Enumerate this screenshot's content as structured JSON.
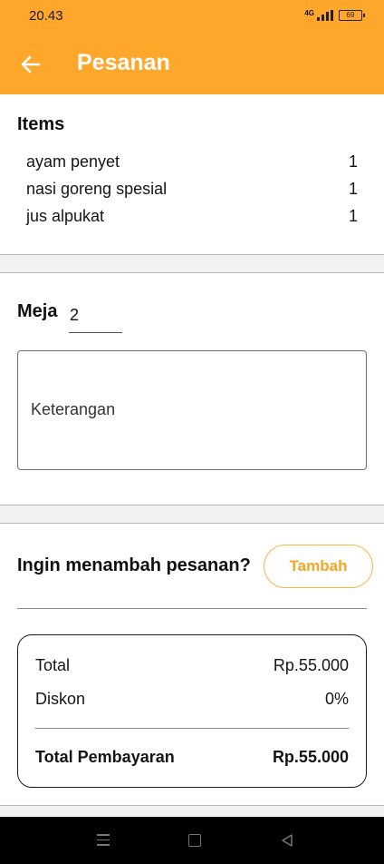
{
  "status_bar": {
    "time": "20.43",
    "network": "4G",
    "battery": "69"
  },
  "app_bar": {
    "title": "Pesanan",
    "back_icon": "arrow-left-icon"
  },
  "items": {
    "title": "Items",
    "list": [
      {
        "name": "ayam penyet",
        "qty": "1"
      },
      {
        "name": "nasi goreng spesial",
        "qty": "1"
      },
      {
        "name": "jus alpukat",
        "qty": "1"
      }
    ]
  },
  "meja": {
    "label": "Meja",
    "value": "2"
  },
  "keterangan": {
    "placeholder": "Keterangan"
  },
  "tambah": {
    "question": "Ingin menambah pesanan?",
    "button_label": "Tambah"
  },
  "summary": {
    "total_label": "Total",
    "total_value": "Rp.55.000",
    "diskon_label": "Diskon",
    "diskon_value": "0%",
    "pembayaran_label": "Total Pembayaran",
    "pembayaran_value": "Rp.55.000"
  },
  "colors": {
    "accent": "#FFA72B",
    "button_text": "#F5A623"
  }
}
